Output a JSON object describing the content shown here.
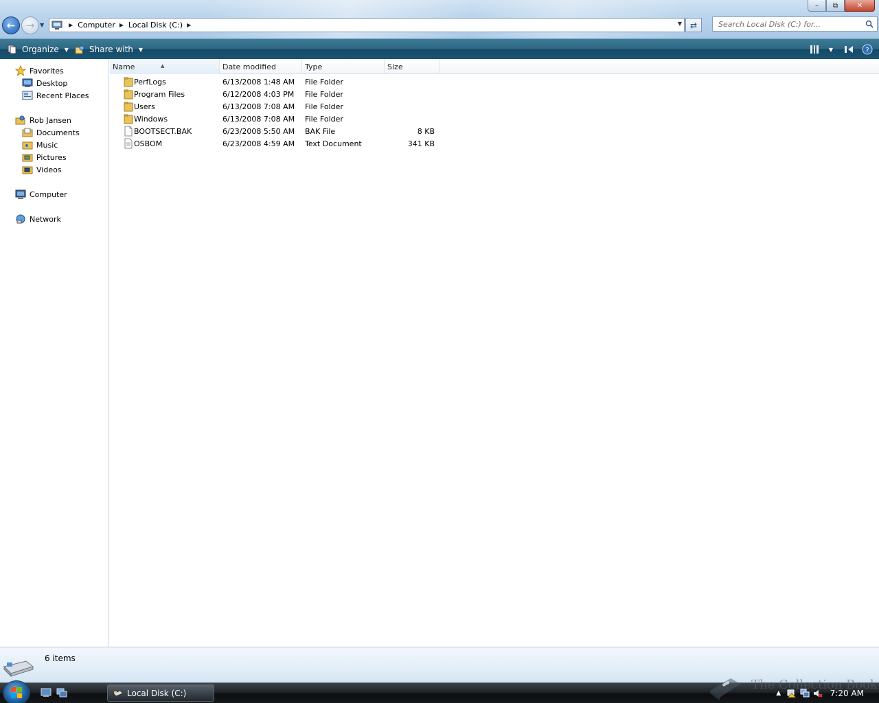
{
  "window": {
    "minimize_glyph": "–",
    "maximize_glyph": "⧉",
    "close_glyph": "✕"
  },
  "address_bar": {
    "crumbs": [
      "Computer",
      "Local Disk (C:)"
    ]
  },
  "search": {
    "placeholder": "Search Local Disk (C:) for..."
  },
  "command_bar": {
    "organize_label": "Organize",
    "share_label": "Share with"
  },
  "nav_pane": {
    "favorites_label": "Favorites",
    "favorites": [
      {
        "label": "Desktop",
        "icon": "desktop-icon"
      },
      {
        "label": "Recent Places",
        "icon": "recent-places-icon"
      }
    ],
    "user_label": "Rob Jansen",
    "user_items": [
      {
        "label": "Documents",
        "icon": "documents-folder-icon"
      },
      {
        "label": "Music",
        "icon": "music-folder-icon"
      },
      {
        "label": "Pictures",
        "icon": "pictures-folder-icon"
      },
      {
        "label": "Videos",
        "icon": "videos-folder-icon"
      }
    ],
    "computer_label": "Computer",
    "network_label": "Network"
  },
  "columns": {
    "name": "Name",
    "date": "Date modified",
    "type": "Type",
    "size": "Size"
  },
  "files": [
    {
      "name": "PerfLogs",
      "date": "6/13/2008 1:48 AM",
      "type": "File Folder",
      "size": "",
      "icon": "folder-icon"
    },
    {
      "name": "Program Files",
      "date": "6/12/2008 4:03 PM",
      "type": "File Folder",
      "size": "",
      "icon": "folder-icon"
    },
    {
      "name": "Users",
      "date": "6/13/2008 7:08 AM",
      "type": "File Folder",
      "size": "",
      "icon": "folder-icon"
    },
    {
      "name": "Windows",
      "date": "6/13/2008 7:08 AM",
      "type": "File Folder",
      "size": "",
      "icon": "folder-icon"
    },
    {
      "name": "BOOTSECT.BAK",
      "date": "6/23/2008 5:50 AM",
      "type": "BAK File",
      "size": "8 KB",
      "icon": "file-icon"
    },
    {
      "name": "OSBOM",
      "date": "6/23/2008 4:59 AM",
      "type": "Text Document",
      "size": "341 KB",
      "icon": "text-file-icon"
    }
  ],
  "details": {
    "item_count": "6 items"
  },
  "taskbar": {
    "active_window": "Local Disk (C:)",
    "clock": "7:20 AM"
  },
  "watermark": {
    "text": "The Collection Book"
  },
  "colors": {
    "command_bar": "#2d6884",
    "taskbar": "#1f2428",
    "folder": "#e8c35a",
    "sort_header": "#e3eef9"
  }
}
